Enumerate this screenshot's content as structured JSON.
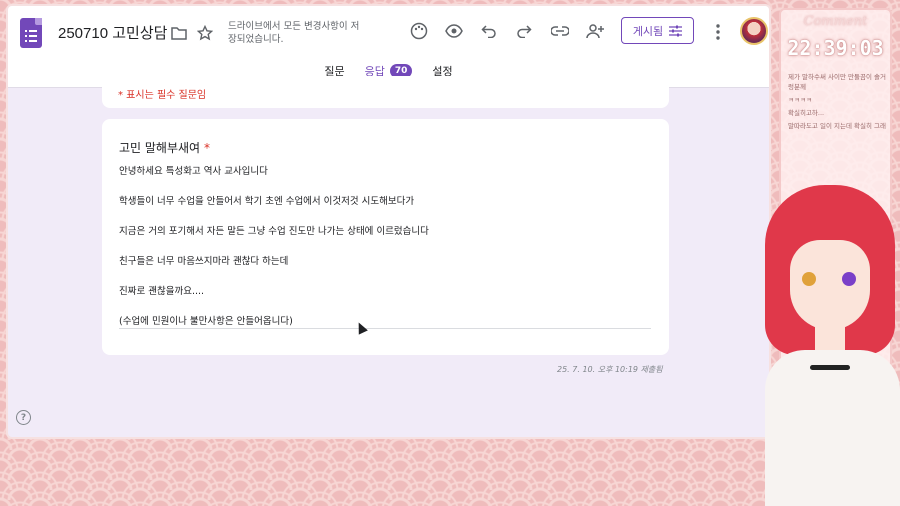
{
  "header": {
    "doc_title": "250710 고민상담",
    "save_status": "드라이브에서 모든 변경사항이 저장되었습니다.",
    "publish_label": "게시됨",
    "icons": [
      "folder-icon",
      "star-icon",
      "palette-icon",
      "preview-icon",
      "undo-icon",
      "redo-icon",
      "link-icon",
      "add-collaborator-icon",
      "tune-icon",
      "more-vert-icon"
    ]
  },
  "tabs": [
    {
      "label": "질문",
      "active": false
    },
    {
      "label": "응답",
      "active": true,
      "badge": "70"
    },
    {
      "label": "설정",
      "active": false
    }
  ],
  "form": {
    "required_note": "* 표시는 필수 질문임",
    "question": {
      "title": "고민 말해부새여",
      "required_mark": "*",
      "answer_lines": [
        "안녕하세요 특성화고 역사 교사입니다",
        "학생들이 너무 수업을 안들어서 학기 초엔 수업에서 이것저것 시도해보다가",
        "지금은 거의 포기해서 자든 말든 그냥 수업 진도만 나가는 상태에 이르렀습니다",
        "친구들은 너무 마음쓰지마라 괜찮다 하는데",
        "진짜로 괜찮을까요....",
        "(수업에 민원이나 불만사항은 안들어옵니다)"
      ]
    },
    "submitted_at": "25. 7. 10. 오후 10:19 제출됨"
  },
  "help": {
    "label": "?"
  },
  "overlay": {
    "comment_title": "Comment",
    "clock": "22:39:03",
    "comments": [
      "제가 말하수써 사이만 만둘끔이 솔거렁분께",
      "ㅋㅋㅋㅋ",
      "확실히고하...",
      "말따라도고 일이 지는데 확실히 그래"
    ]
  }
}
